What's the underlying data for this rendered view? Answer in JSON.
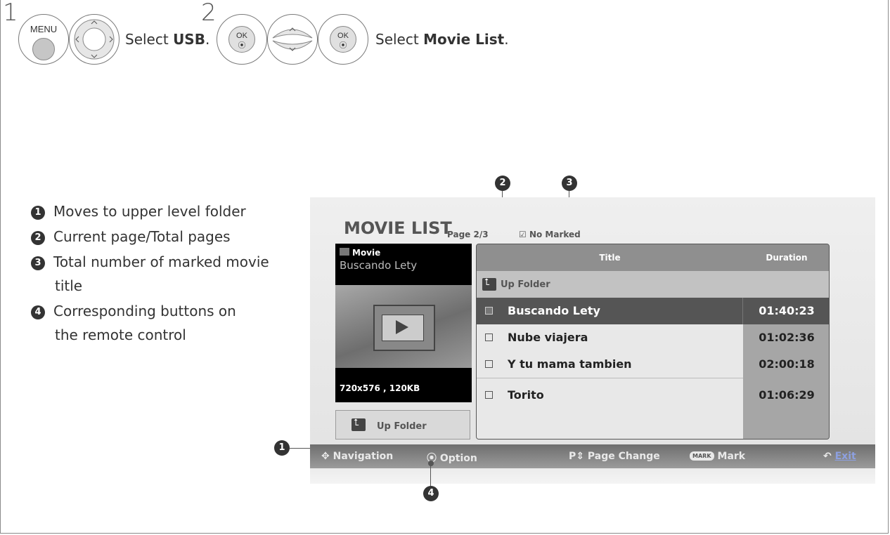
{
  "steps": [
    {
      "number": "1",
      "buttons": [
        "MENU"
      ],
      "instruction_prefix": "Select ",
      "instruction_bold": "USB",
      "instruction_suffix": "."
    },
    {
      "number": "2",
      "buttons": [
        "OK",
        "OK"
      ],
      "instruction_prefix": "Select ",
      "instruction_bold": "Movie List",
      "instruction_suffix": "."
    }
  ],
  "legend": [
    {
      "badge": "1",
      "lines": [
        "Moves to upper level folder"
      ]
    },
    {
      "badge": "2",
      "lines": [
        "Current page/Total pages"
      ]
    },
    {
      "badge": "3",
      "lines": [
        "Total number of marked movie",
        "title"
      ]
    },
    {
      "badge": "4",
      "lines": [
        "Corresponding buttons on",
        "the remote control"
      ]
    }
  ],
  "callouts": [
    "1",
    "2",
    "3",
    "4"
  ],
  "screen": {
    "title": "MOVIE LIST",
    "page_info": "Page 2/3",
    "marked_info": "No Marked",
    "preview": {
      "label": "Movie",
      "name": "Buscando Lety",
      "meta": "720x576 , 120KB"
    },
    "up_folder_button": "Up Folder",
    "list": {
      "col_title": "Title",
      "col_duration": "Duration",
      "up_folder_row": "Up Folder",
      "rows": [
        {
          "title": "Buscando Lety",
          "duration": "01:40:23",
          "selected": true
        },
        {
          "title": "Nube viajera",
          "duration": "01:02:36",
          "selected": false
        },
        {
          "title": "Y tu mama tambien",
          "duration": "02:00:18",
          "selected": false
        },
        {
          "title": "Torito",
          "duration": "01:06:29",
          "selected": false
        }
      ]
    },
    "bottom_bar": {
      "navigation": "Navigation",
      "option": "Option",
      "page_change_prefix": "P",
      "page_change": "Page Change",
      "mark_badge": "MARK",
      "mark": "Mark",
      "exit": "Exit"
    }
  }
}
